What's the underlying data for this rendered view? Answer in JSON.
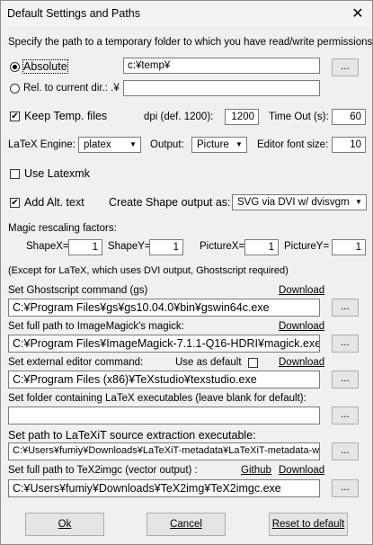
{
  "window": {
    "title": "Default Settings and Paths",
    "close_glyph": "✕"
  },
  "temp": {
    "instruction": "Specify the path to a temporary folder to which you have read/write permissions:",
    "absolute_label": "Absolute",
    "absolute_value": "c:¥temp¥",
    "relative_label": "Rel. to current dir.: .¥",
    "relative_value": "",
    "browse": "...",
    "keep_label": "Keep Temp. files"
  },
  "dpi": {
    "label": "dpi (def. 1200):",
    "value": "1200"
  },
  "timeout": {
    "label": "Time Out (s):",
    "value": "60"
  },
  "engine": {
    "label": "LaTeX Engine:",
    "value": "platex"
  },
  "output": {
    "label": "Output:",
    "value": "Picture"
  },
  "editor_font": {
    "label": "Editor font size:",
    "value": "10"
  },
  "latexmk": {
    "label": "Use Latexmk"
  },
  "alt_text": {
    "label": "Add Alt. text"
  },
  "shape": {
    "label": "Create Shape output as:",
    "value": "SVG via DVI w/ dvisvgm"
  },
  "rescale": {
    "label": "Magic rescaling factors:",
    "shapex_label": "ShapeX=",
    "shapex_value": "1",
    "shapey_label": "ShapeY=",
    "shapey_value": "1",
    "picturex_label": "PictureX=",
    "picturex_value": "1",
    "picturey_label": "PictureY=",
    "picturey_value": "1",
    "note": "(Except for LaTeX, which uses DVI output, Ghostscript required)"
  },
  "gs": {
    "label": "Set Ghostscript command (gs)",
    "download": "Download",
    "value": "C:¥Program Files¥gs¥gs10.04.0¥bin¥gswin64c.exe",
    "browse": "..."
  },
  "magick": {
    "label": "Set full path to ImageMagick's magick:",
    "download": "Download",
    "value": "C:¥Program Files¥ImageMagick-7.1.1-Q16-HDRI¥magick.exe",
    "browse": "..."
  },
  "editor": {
    "label": "Set external editor command:",
    "default_label": "Use as default",
    "download": "Download",
    "value": "C:¥Program Files (x86)¥TeXstudio¥texstudio.exe",
    "browse": "..."
  },
  "latex_folder": {
    "label": "Set folder containing LaTeX executables (leave blank for default):",
    "value": "",
    "browse": "..."
  },
  "latexit": {
    "label": "Set path to LaTeXiT source extraction executable:",
    "value": "C:¥Users¥fumiy¥Downloads¥LaTeXiT-metadata¥LaTeXiT-metadata-wi",
    "browse": "..."
  },
  "tex2img": {
    "label": "Set full path to TeX2imgc (vector output) :",
    "github": "Github",
    "download": "Download",
    "value": "C:¥Users¥fumiy¥Downloads¥TeX2img¥TeX2imgc.exe",
    "browse": "..."
  },
  "buttons": {
    "ok": "Ok",
    "cancel": "Cancel",
    "reset": "Reset to default"
  }
}
